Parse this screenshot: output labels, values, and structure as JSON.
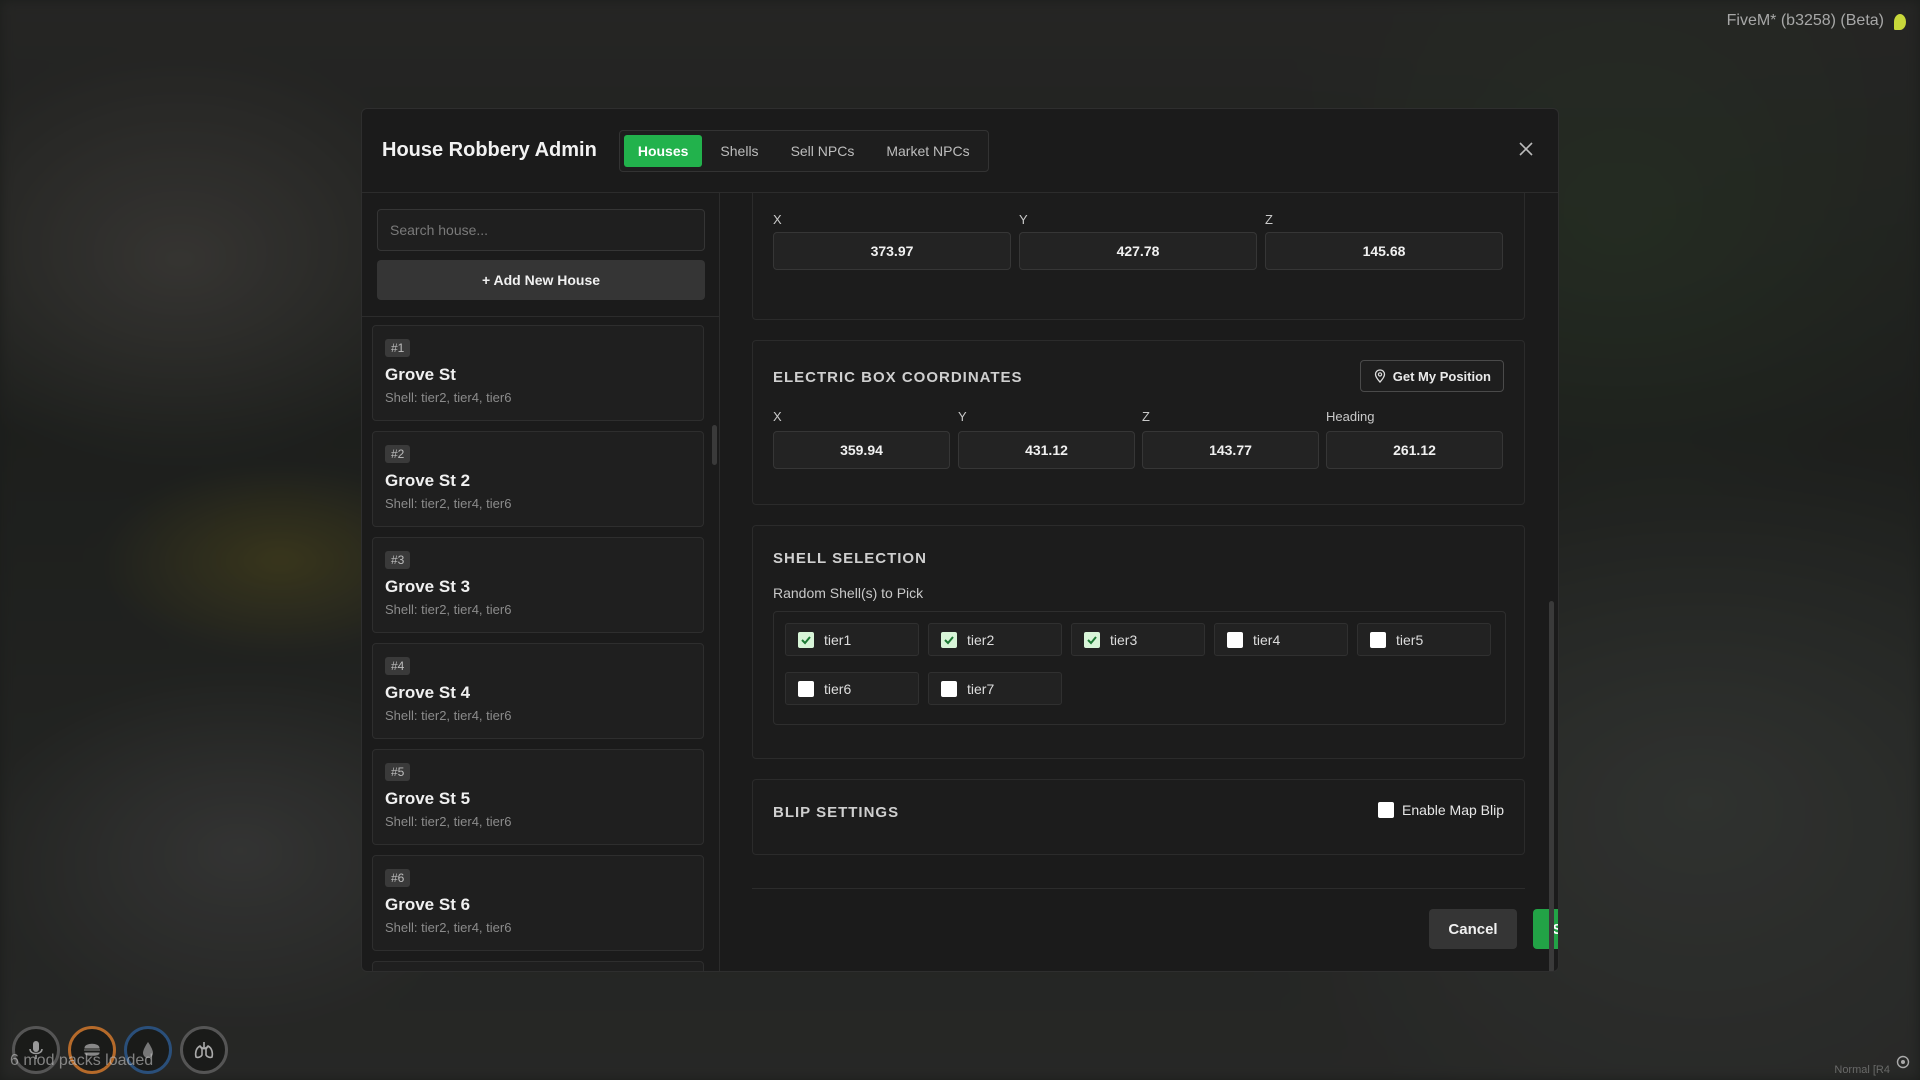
{
  "overlay": {
    "fivem_label": "FiveM* (b3258) (Beta)",
    "mods_text": "6 mod packs loaded",
    "corner_text": "Normal [R4"
  },
  "header": {
    "title": "House Robbery Admin",
    "tabs": [
      {
        "label": "Houses",
        "active": true
      },
      {
        "label": "Shells",
        "active": false
      },
      {
        "label": "Sell NPCs",
        "active": false
      },
      {
        "label": "Market NPCs",
        "active": false
      }
    ]
  },
  "sidebar": {
    "search_placeholder": "Search house...",
    "add_label": "+ Add New House",
    "houses": [
      {
        "id": "#1",
        "name": "Grove St",
        "shell": "Shell: tier2, tier4, tier6"
      },
      {
        "id": "#2",
        "name": "Grove St 2",
        "shell": "Shell: tier2, tier4, tier6"
      },
      {
        "id": "#3",
        "name": "Grove St 3",
        "shell": "Shell: tier2, tier4, tier6"
      },
      {
        "id": "#4",
        "name": "Grove St 4",
        "shell": "Shell: tier2, tier4, tier6"
      },
      {
        "id": "#5",
        "name": "Grove St 5",
        "shell": "Shell: tier2, tier4, tier6"
      },
      {
        "id": "#6",
        "name": "Grove St 6",
        "shell": "Shell: tier2, tier4, tier6"
      }
    ]
  },
  "entrance": {
    "x_label": "X",
    "y_label": "Y",
    "z_label": "Z",
    "x": "373.97",
    "y": "427.78",
    "z": "145.68"
  },
  "electric": {
    "title": "ELECTRIC BOX COORDINATES",
    "position_button": "Get My Position",
    "x_label": "X",
    "y_label": "Y",
    "z_label": "Z",
    "heading_label": "Heading",
    "x": "359.94",
    "y": "431.12",
    "z": "143.77",
    "heading": "261.12"
  },
  "shell": {
    "title": "SHELL SELECTION",
    "subtitle": "Random Shell(s) to Pick",
    "options": [
      {
        "label": "tier1",
        "checked": true
      },
      {
        "label": "tier2",
        "checked": true
      },
      {
        "label": "tier3",
        "checked": true
      },
      {
        "label": "tier4",
        "checked": false
      },
      {
        "label": "tier5",
        "checked": false
      },
      {
        "label": "tier6",
        "checked": false
      },
      {
        "label": "tier7",
        "checked": false
      }
    ]
  },
  "blip": {
    "title": "BLIP SETTINGS",
    "enable_label": "Enable Map Blip",
    "enabled": false
  },
  "footer": {
    "cancel_label": "Cancel",
    "save_label": "Save"
  },
  "colors": {
    "accent": "#22b24c",
    "panel": "#1b1b1b"
  }
}
